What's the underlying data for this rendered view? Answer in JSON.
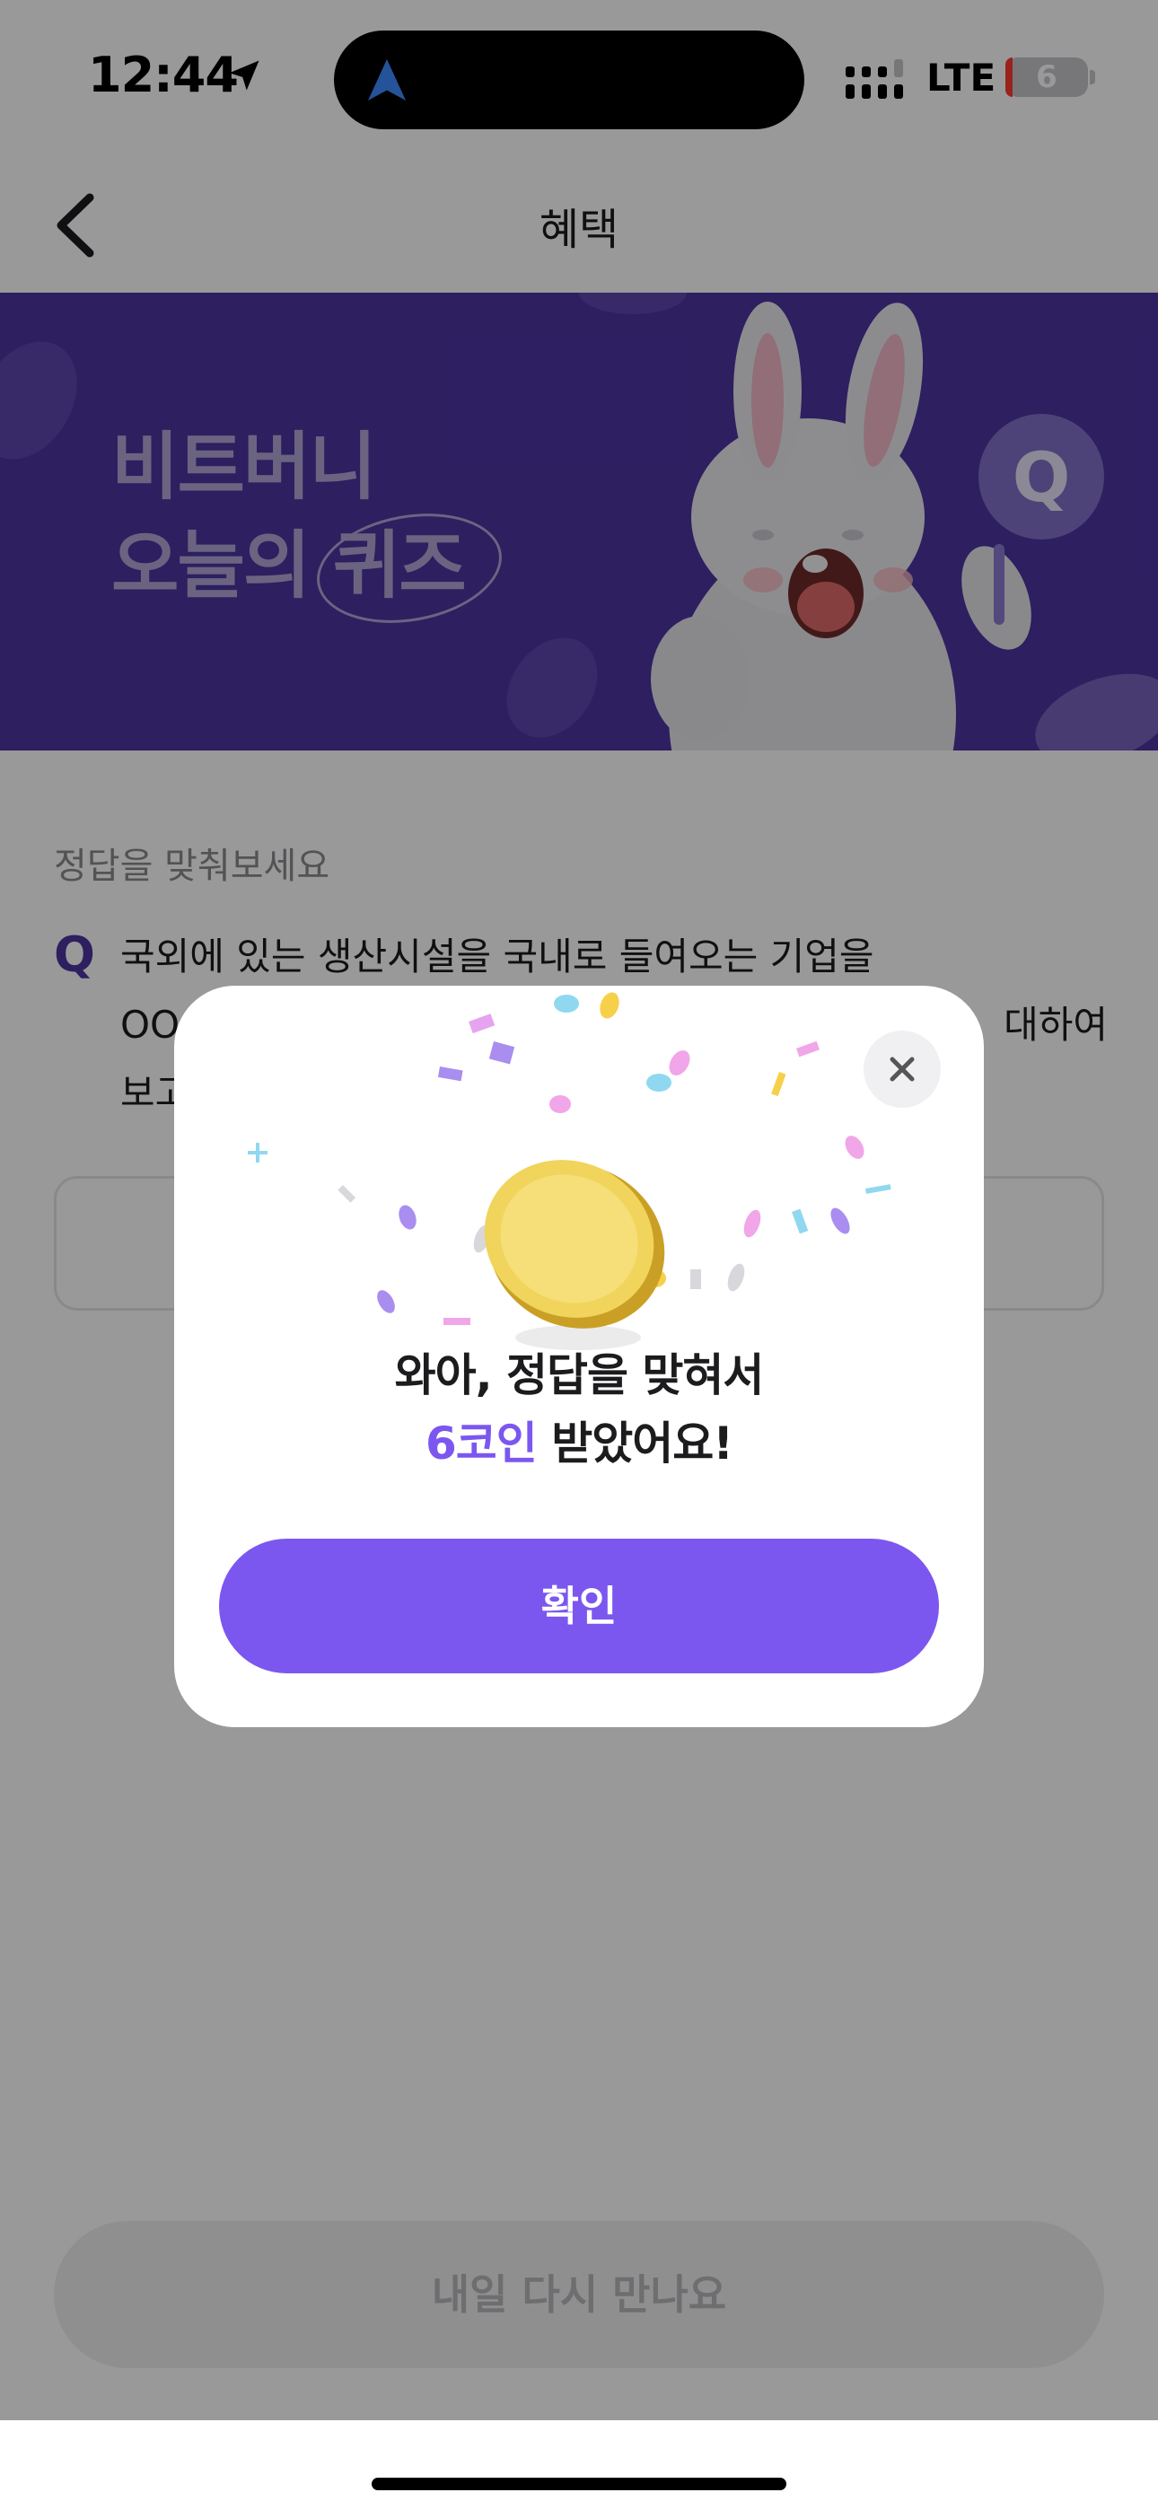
{
  "status_bar": {
    "time": "12:44",
    "carrier": "LTE",
    "battery_level": "6",
    "icons": [
      "location-arrow-icon",
      "navigation-arrow-icon",
      "signal-icon",
      "battery-icon"
    ]
  },
  "nav": {
    "title": "혜택",
    "back_icon": "chevron-left-icon"
  },
  "banner": {
    "title_line1": "비트버니",
    "title_line2": "오늘의 퀴즈",
    "background_color": "#4b34a1",
    "text_color": "#b1a7d8"
  },
  "quiz": {
    "prompt": "정답을 맞춰보세요",
    "q_label": "Q",
    "question_line1": "국외에 있는 생산시설을 국내로 들여오는 기업을",
    "question_line2_start": "OO",
    "question_line2_end": "대하여",
    "question_line3_start": "보고"
  },
  "bottom_button": {
    "label": "내일 다시 만나요"
  },
  "modal": {
    "line1": "와아, 정답을 맞혀서",
    "coin_amount": "6코인",
    "line2_rest": " 받았어요!",
    "confirm_label": "확인",
    "close_icon": "close-icon",
    "accent_color": "#7b57f0"
  }
}
